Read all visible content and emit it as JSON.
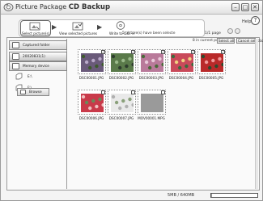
{
  "window": {
    "title_prefix": "Picture Package",
    "title_product": "CD Backup",
    "controls": {
      "minimize": "–",
      "maximize": "□",
      "close": "✕"
    }
  },
  "help": {
    "label": "Help",
    "icon": "?"
  },
  "steps": [
    {
      "label": "Select picture(s)",
      "icon": "select-pictures-icon"
    },
    {
      "label": "View selected pictures",
      "icon": "view-selected-icon"
    },
    {
      "label": "Write to C.D.-R",
      "icon": "disc-write-icon"
    }
  ],
  "selection_info": "5 picture(s) have been selecte",
  "page_info": "1/1 page",
  "sidebar": {
    "tabs": [
      {
        "label": "Captured folder",
        "icon": "folder-icon"
      },
      {
        "label": "20020831(1)",
        "icon": "folder-icon"
      },
      {
        "label": "Memory device",
        "icon": "memory-device-icon"
      }
    ],
    "drives": [
      {
        "label": "E:\\",
        "icon": "drive-icon"
      },
      {
        "label": "F:\\",
        "icon": "drive-icon"
      }
    ],
    "browse_tab": {
      "label": "Browse",
      "icon": "browse-icon"
    }
  },
  "content": {
    "count_info": "8 in current page",
    "select_all": "Select all",
    "cancel_selection": "Cancel selectio",
    "thumbnails": [
      {
        "label": "DSC00001.JPG",
        "checked": true,
        "palette": "purple-flowers"
      },
      {
        "label": "DSC00002.JPG",
        "checked": true,
        "palette": "green-garden"
      },
      {
        "label": "DSC00003.JPG",
        "checked": true,
        "palette": "pink-flowers"
      },
      {
        "label": "DSC00004.JPG",
        "checked": true,
        "palette": "tulips"
      },
      {
        "label": "DSC00005.JPG",
        "checked": true,
        "palette": "red-flowers"
      },
      {
        "label": "DSC00006.JPG",
        "checked": false,
        "palette": "red-bouquet"
      },
      {
        "label": "DSC00007.JPG",
        "checked": false,
        "palette": "white-flowers"
      },
      {
        "label": "MOV00001.MPG",
        "checked": false,
        "palette": "video-grey"
      }
    ]
  },
  "status": {
    "capacity_text": "5MB / 640MB",
    "capacity_used_fraction": 0.01
  }
}
